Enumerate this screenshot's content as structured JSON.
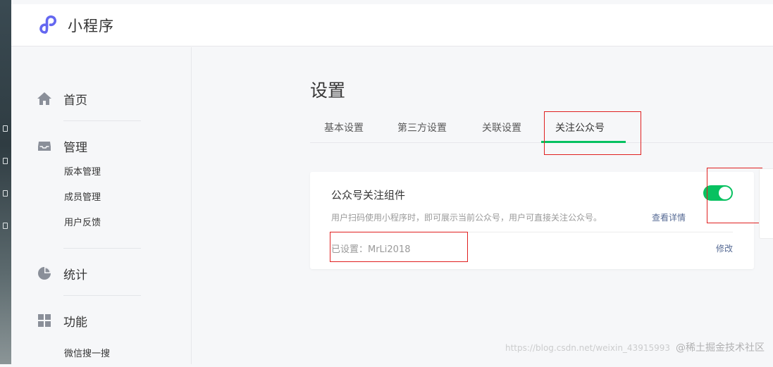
{
  "app": {
    "brand_name": "小程序",
    "accent_color": "#07c160",
    "logo_color": "#6467f0",
    "link_color": "#576b95"
  },
  "sidebar": {
    "groups": [
      {
        "label": "首页",
        "icon": "home-icon",
        "subitems": []
      },
      {
        "label": "管理",
        "icon": "inbox-icon",
        "subitems": [
          "版本管理",
          "成员管理",
          "用户反馈"
        ]
      },
      {
        "label": "统计",
        "icon": "pie-chart-icon",
        "subitems": []
      },
      {
        "label": "功能",
        "icon": "grid-icon",
        "subitems": [
          "微信搜一搜"
        ]
      }
    ]
  },
  "main": {
    "title": "设置",
    "tabs": [
      {
        "label": "基本设置",
        "active": false
      },
      {
        "label": "第三方设置",
        "active": false
      },
      {
        "label": "关联设置",
        "active": false
      },
      {
        "label": "关注公众号",
        "active": true
      }
    ],
    "card": {
      "title": "公众号关注组件",
      "description": "用户扫码使用小程序时，即可展示当前公众号，用户可直接关注公众号。",
      "detail_link": "查看详情",
      "enabled": true,
      "status": "已设置：MrLi2018",
      "action": "修改"
    }
  },
  "watermark": {
    "url": "https://blog.csdn.net/weixin_43915993",
    "text": "@稀土掘金技术社区"
  }
}
